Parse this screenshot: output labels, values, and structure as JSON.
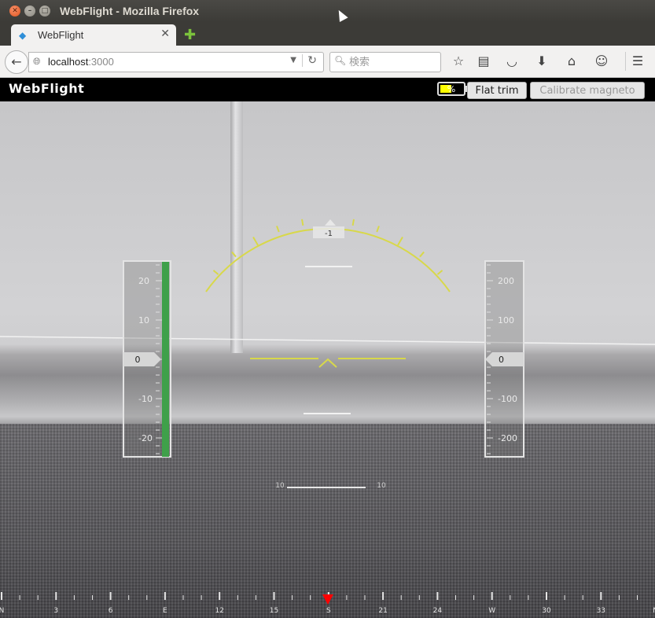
{
  "window": {
    "title": "WebFlight - Mozilla Firefox"
  },
  "tabs": [
    {
      "label": "WebFlight"
    }
  ],
  "navbar": {
    "url_host": "localhost",
    "url_port": ":3000",
    "search_placeholder": "検索"
  },
  "app": {
    "brand": "WebFlight",
    "battery": {
      "percent_label": "%",
      "level": 0.5,
      "level_color": "#ffff00"
    },
    "flat_trim_label": "Flat trim",
    "calibrate_label": "Calibrate magneto"
  },
  "hud": {
    "accent_color": "#d8d84a",
    "roll_value": "-1",
    "altitude": {
      "ticks": [
        "20",
        "10",
        "-10",
        "-20"
      ],
      "current": "0",
      "bar_color": "#3fa04a"
    },
    "speed": {
      "ticks": [
        "200",
        "100",
        "-100",
        "-200"
      ],
      "current": "0"
    },
    "pitch_ladder": {
      "left_label": "10",
      "right_label": "10"
    },
    "compass": {
      "labels": [
        "N",
        "3",
        "6",
        "E",
        "12",
        "15",
        "S",
        "21",
        "24",
        "W",
        "30",
        "33",
        "N"
      ],
      "marker_color": "#ff0000"
    }
  }
}
